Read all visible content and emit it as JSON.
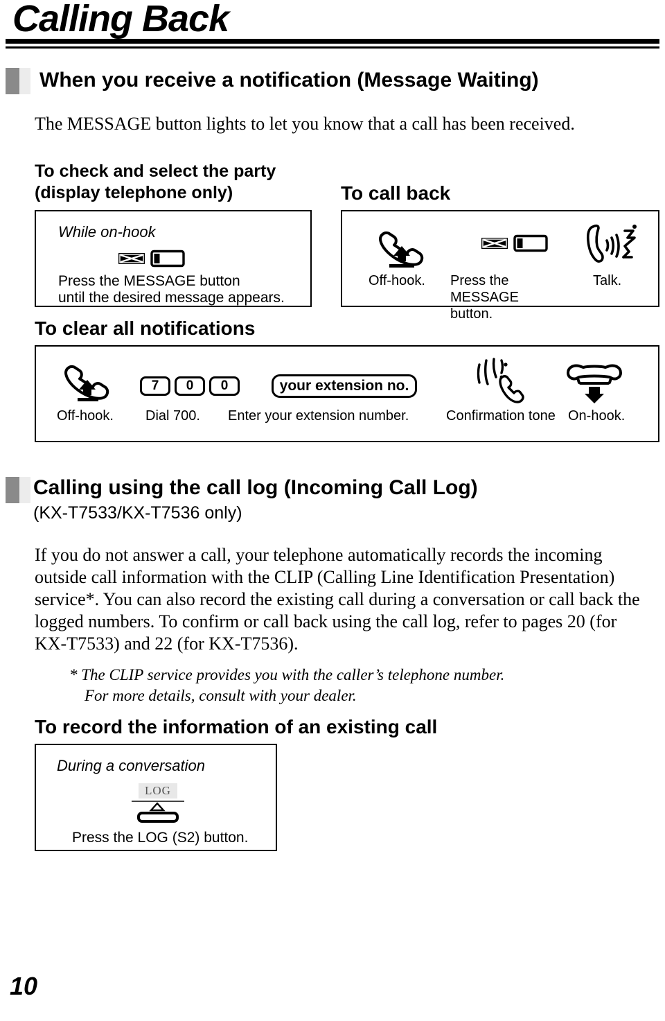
{
  "page": {
    "title": "Calling Back",
    "number": "10"
  },
  "section1": {
    "heading": "When you receive a notification (Message Waiting)",
    "intro": "The MESSAGE button lights to let you know that a call has been received.",
    "check_select": {
      "title_line1": "To check and select the party",
      "title_line2": "(display telephone only)",
      "box": {
        "context": "While on-hook",
        "icon": "message-button-icon",
        "caption_line1": "Press the MESSAGE button",
        "caption_line2": "until the desired message appears."
      }
    },
    "call_back": {
      "title": "To call back",
      "steps": [
        {
          "icon": "handset-off-hook-icon",
          "caption": "Off-hook."
        },
        {
          "icon": "message-button-icon",
          "caption": "Press the MESSAGE button."
        },
        {
          "icon": "talk-icon",
          "caption": "Talk."
        }
      ]
    },
    "clear_all": {
      "title": "To clear all notifications",
      "steps": [
        {
          "icon": "handset-off-hook-icon",
          "caption": "Off-hook."
        },
        {
          "icon": "keypad-icon",
          "keys": [
            "7",
            "0",
            "0"
          ],
          "caption": "Dial 700."
        },
        {
          "icon": "pill-entry-icon",
          "pill_text": "your extension no.",
          "caption": "Enter your extension number."
        },
        {
          "icon": "confirmation-tone-icon",
          "caption": "Confirmation tone"
        },
        {
          "icon": "handset-on-hook-icon",
          "caption": "On-hook."
        }
      ]
    }
  },
  "section2": {
    "heading": "Calling using the call log (Incoming Call Log)",
    "subheading": "(KX-T7533/KX-T7536 only)",
    "body_line1": "If you do not answer a call, your telephone automatically records the incoming",
    "body_line2": "outside call information with the CLIP (Calling Line Identification Presentation)",
    "body_line3": "service*. You can also record the existing call during a conversation or call back the",
    "body_line4": "logged numbers. To confirm or call back using the call log, refer to pages 20 (for",
    "body_line5": "KX-T7533) and 22 (for KX-T7536).",
    "footnote_line1": "* The CLIP service provides you with the caller’s telephone number.",
    "footnote_line2": "For more details, consult with your dealer.",
    "record_existing": {
      "title": "To record the information of an existing call",
      "box": {
        "context": "During a conversation",
        "button_label": "LOG",
        "caption": "Press the LOG (S2) button."
      }
    }
  }
}
